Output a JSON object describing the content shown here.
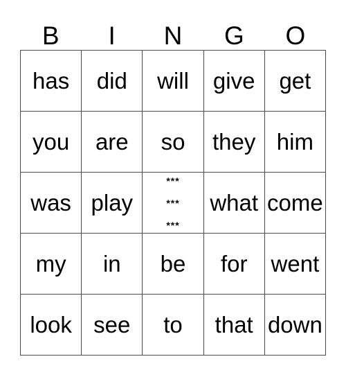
{
  "card": {
    "title": "BINGO",
    "header_letters": [
      "B",
      "I",
      "N",
      "G",
      "O"
    ],
    "free_space": {
      "lines": [
        "***",
        "***",
        "***"
      ]
    },
    "rows": [
      {
        "cells": [
          {
            "text": "has"
          },
          {
            "text": "did"
          },
          {
            "text": "will"
          },
          {
            "text": "give"
          },
          {
            "text": "get"
          }
        ]
      },
      {
        "cells": [
          {
            "text": "you"
          },
          {
            "text": "are"
          },
          {
            "text": "so"
          },
          {
            "text": "they"
          },
          {
            "text": "him"
          }
        ]
      },
      {
        "cells": [
          {
            "text": "was"
          },
          {
            "text": "play"
          },
          {
            "text": "***"
          },
          {
            "text": "what"
          },
          {
            "text": "come"
          }
        ]
      },
      {
        "cells": [
          {
            "text": "my"
          },
          {
            "text": "in"
          },
          {
            "text": "be"
          },
          {
            "text": "for"
          },
          {
            "text": "went"
          }
        ]
      },
      {
        "cells": [
          {
            "text": "look"
          },
          {
            "text": "see"
          },
          {
            "text": "to"
          },
          {
            "text": "that"
          },
          {
            "text": "down"
          }
        ]
      }
    ],
    "colors": {
      "background": "#ffffff",
      "text": "#000000",
      "grid_line": "#4a4a4a"
    }
  }
}
